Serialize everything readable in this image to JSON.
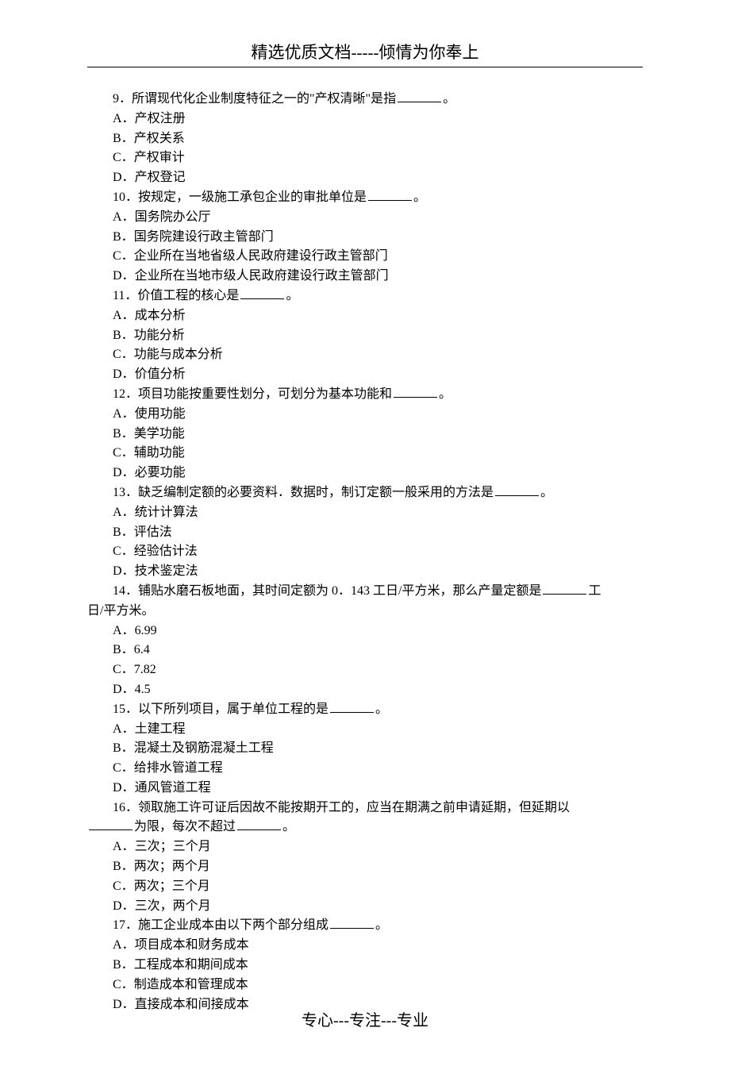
{
  "header": "精选优质文档-----倾情为你奉上",
  "footer": "专心---专注---专业",
  "questions": [
    {
      "num": "9",
      "text_before": "所谓现代化企业制度特征之一的\"产权清晰\"是指",
      "text_after": "。",
      "options": {
        "A": "产权注册",
        "B": "产权关系",
        "C": "产权审计",
        "D": "产权登记"
      }
    },
    {
      "num": "10",
      "text_before": "按规定，一级施工承包企业的审批单位是",
      "text_after": "。",
      "options": {
        "A": "国务院办公厅",
        "B": "国务院建设行政主管部门",
        "C": "企业所在当地省级人民政府建设行政主管部门",
        "D": "企业所在当地市级人民政府建设行政主管部门"
      }
    },
    {
      "num": "11",
      "text_before": "价值工程的核心是",
      "text_after": "。",
      "options": {
        "A": "成本分析",
        "B": "功能分析",
        "C": "功能与成本分析",
        "D": "价值分析"
      }
    },
    {
      "num": "12",
      "text_before": "项目功能按重要性划分，可划分为基本功能和",
      "text_after": "。",
      "options": {
        "A": "使用功能",
        "B": "美学功能",
        "C": "辅助功能",
        "D": "必要功能"
      }
    },
    {
      "num": "13",
      "text_before": "缺乏编制定额的必要资料．数据时，制订定额一般采用的方法是",
      "text_after": "。",
      "options": {
        "A": "统计计算法",
        "B": "评估法",
        "C": "经验估计法",
        "D": "技术鉴定法"
      }
    },
    {
      "num": "14",
      "line1_before": "铺贴水磨石板地面，其时间定额为 0．143 工日/平方米，那么产量定额是",
      "line1_after": "工",
      "line2": "日/平方米。",
      "options": {
        "A": "6.99",
        "B": "6.4",
        "C": "7.82",
        "D": "4.5"
      }
    },
    {
      "num": "15",
      "text_before": "以下所列项目，属于单位工程的是",
      "text_after": "。",
      "options": {
        "A": "土建工程",
        "B": "混凝土及钢筋混凝土工程",
        "C": "给排水管道工程",
        "D": "通风管道工程"
      }
    },
    {
      "num": "16",
      "line1": "领取施工许可证后因故不能按期开工的，应当在期满之前申请延期，但延期以",
      "line2_mid": "为限，每次不超过",
      "line2_after": "。",
      "options": {
        "A": "三次；三个月",
        "B": "两次；两个月",
        "C": "两次；三个月",
        "D": "三次，两个月"
      }
    },
    {
      "num": "17",
      "text_before": "施工企业成本由以下两个部分组成",
      "text_after": "。",
      "options": {
        "A": "项目成本和财务成本",
        "B": "工程成本和期间成本",
        "C": "制造成本和管理成本",
        "D": "直接成本和间接成本"
      }
    }
  ]
}
